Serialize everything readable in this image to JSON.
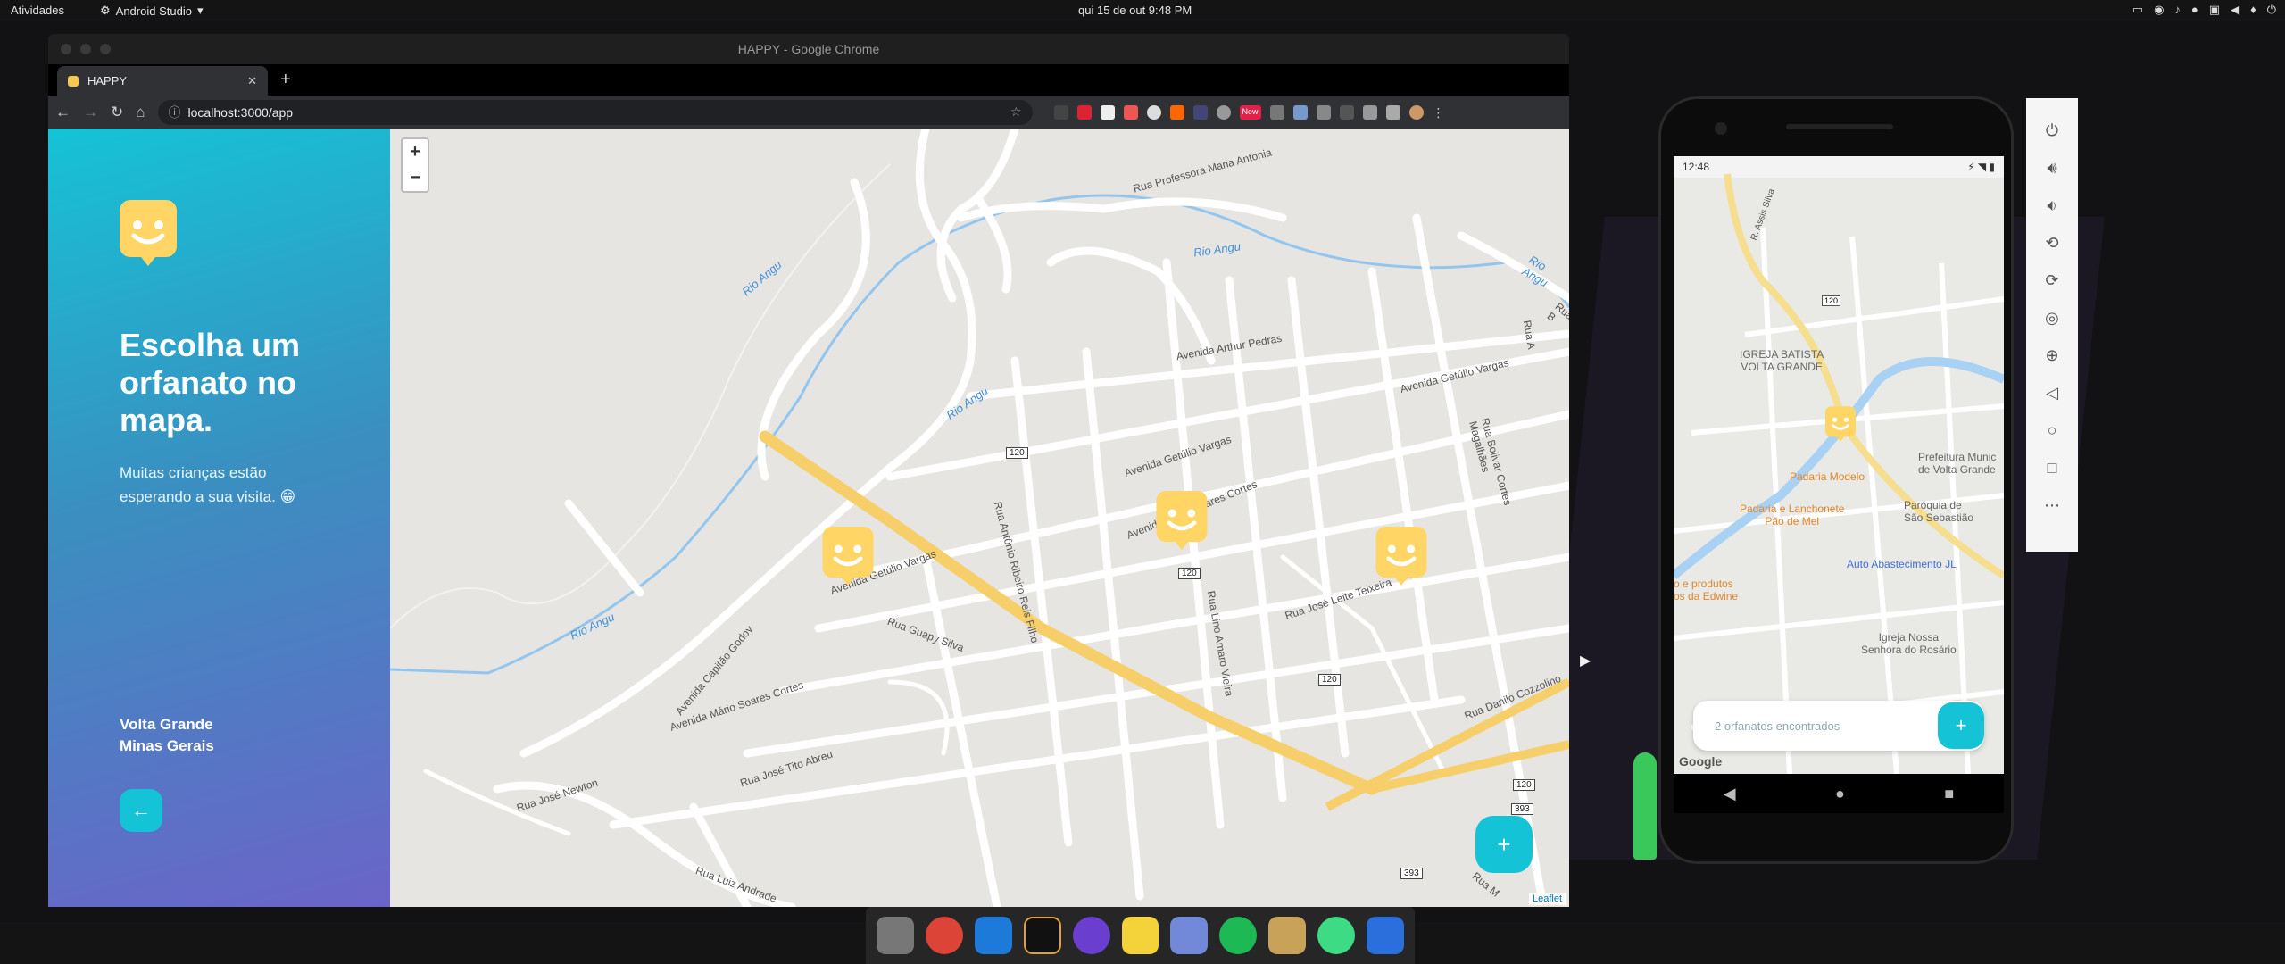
{
  "topbar": {
    "activities": "Atividades",
    "app": "Android Studio",
    "clock": "qui 15 de out   9:48 PM"
  },
  "chrome": {
    "window_title": "HAPPY - Google Chrome",
    "tab_title": "HAPPY",
    "url": "localhost:3000/app",
    "new_badge": "New"
  },
  "app": {
    "heading": "Escolha um orfanato no mapa.",
    "subtitle": "Muitas crianças estão esperando a sua visita. 😁",
    "city": "Volta Grande",
    "state": "Minas Gerais",
    "back_icon": "←",
    "add_icon": "+",
    "zoom_in": "+",
    "zoom_out": "−",
    "attribution": "Leaflet"
  },
  "map_labels": {
    "rio1": "Rio Angu",
    "rio2": "Rio Angu",
    "rio3": "Rio Angu",
    "rio4": "Rio Angu",
    "rio5": "Rio Angu",
    "professora": "Rua Professora Maria Antonia",
    "arthur": "Avenida Arthur Pedras",
    "getulio1": "Avenida Getúlio Vargas",
    "getulio2": "Avenida Getúlio Vargas",
    "getulio3": "Avenida Getúlio Vargas",
    "ruaA": "Rua A",
    "ruaB": "Rua B",
    "bolivar": "Rua Bolivar Cortes Magalhães",
    "antonio": "Rua Antônio Ribeiro Reis Filho",
    "mario1": "Avenida Mário Soares Cortes",
    "mario2": "Avenida Mário Soares Cortes",
    "guapy": "Rua Guapy Silva",
    "capitao": "Avenida Capitão Godoy",
    "lino": "Rua Lino Amaro Vieira",
    "leite": "Rua José Leite Teixeira",
    "danilo": "Rua Danilo Cozzolino",
    "tito": "Rua José Tito Abreu",
    "newton": "Rua José Newton",
    "luiz": "Rua Luiz Andrade",
    "ruaM": "Rua M",
    "shield120a": "120",
    "shield120b": "120",
    "shield120c": "120",
    "shield120d": "120",
    "shield393a": "393",
    "shield393b": "393"
  },
  "phone": {
    "time": "12:48",
    "search_text": "2 orfanatos encontrados",
    "add_icon": "+",
    "google": "Google",
    "labels": {
      "igreja": "IGREJA BATISTA\nVOLTA GRANDE",
      "prefeitura": "Prefeitura Munic\nde Volta Grande",
      "padaria": "Padaria Modelo",
      "padaria2": "Padaria e Lanchonete\nPão de Mel",
      "paroquia": "Paróquia de\nSão Sebastião",
      "auto": "Auto Abastecimento JL",
      "produtos": "o e produtos\nos da Edwine",
      "rosario": "Igreja Nossa\nSenhora do Rosário",
      "assis": "R. Assis Silva",
      "shield": "120"
    }
  },
  "colors": {
    "accent": "#15c3d6",
    "marker": "#ffd666",
    "road_major": "#f6cf6b",
    "river": "#92c6ef",
    "map_bg": "#e6e5e1"
  }
}
